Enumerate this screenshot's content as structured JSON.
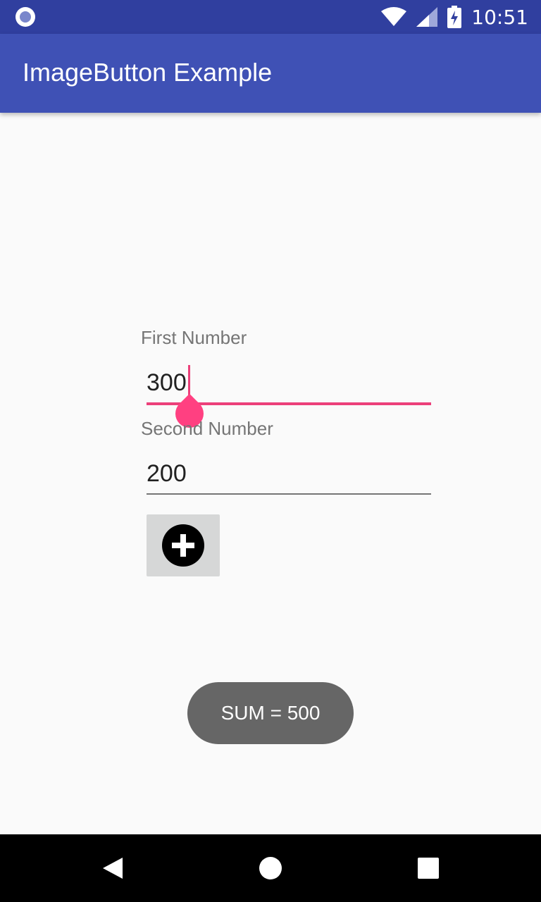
{
  "status_bar": {
    "time": "10:51",
    "icons": [
      "notification-icon",
      "wifi-icon",
      "signal-icon",
      "battery-charging-icon"
    ]
  },
  "app_bar": {
    "title": "ImageButton Example"
  },
  "form": {
    "first_label": "First Number",
    "first_value": "300",
    "second_label": "Second Number",
    "second_value": "200",
    "add_button_icon": "add-circle-icon"
  },
  "toast": {
    "text": "SUM = 500"
  },
  "nav_bar": {
    "buttons": [
      "back-icon",
      "home-icon",
      "recents-icon"
    ]
  },
  "colors": {
    "status_bar": "#303f9f",
    "app_bar": "#3f51b5",
    "accent": "#ec407a",
    "toast_bg": "#666666"
  }
}
